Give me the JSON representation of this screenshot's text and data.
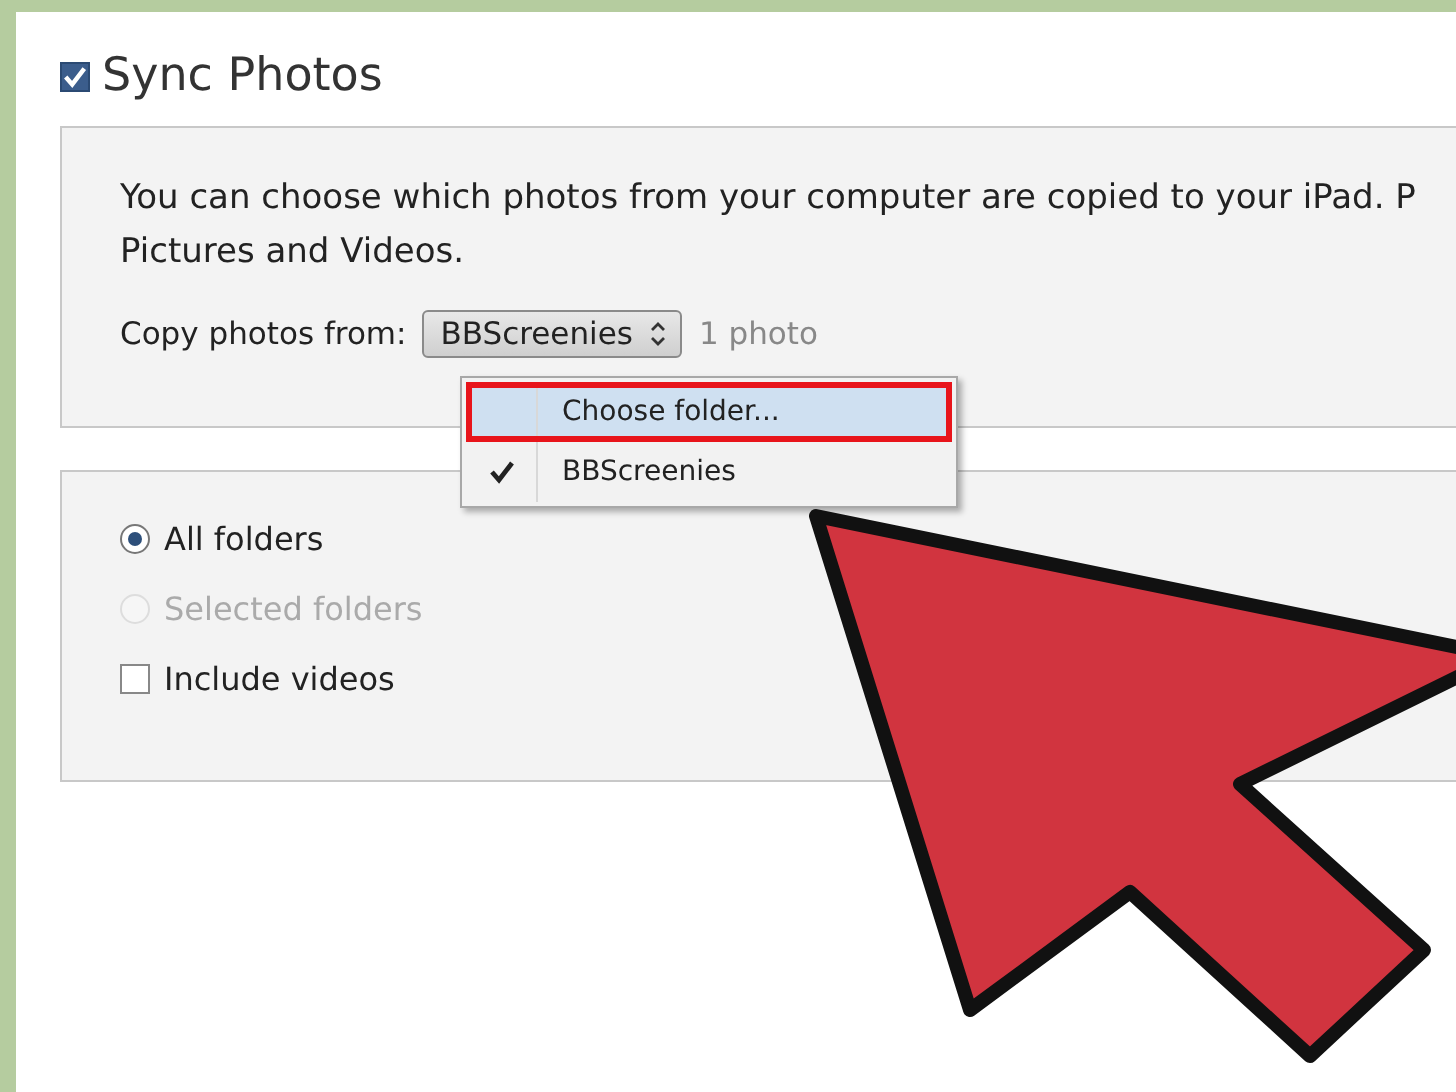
{
  "sync": {
    "label": "Sync Photos",
    "checked": true
  },
  "description": [
    "You can choose which photos from your computer are copied to your iPad. P",
    "Pictures and Videos."
  ],
  "copy_from": {
    "label": "Copy photos from:",
    "value": "BBScreenies",
    "count": "1 photo"
  },
  "menu": {
    "items": [
      {
        "label": "Choose folder...",
        "checked": false,
        "selected": true,
        "annotated": true
      },
      {
        "label": "BBScreenies",
        "checked": true,
        "selected": false,
        "annotated": false
      }
    ]
  },
  "options": [
    {
      "kind": "radio",
      "label": "All folders",
      "selected": true,
      "disabled": false
    },
    {
      "kind": "radio",
      "label": "Selected folders",
      "selected": false,
      "disabled": true
    },
    {
      "kind": "checkbox",
      "label": "Include videos",
      "checked": false
    }
  ]
}
